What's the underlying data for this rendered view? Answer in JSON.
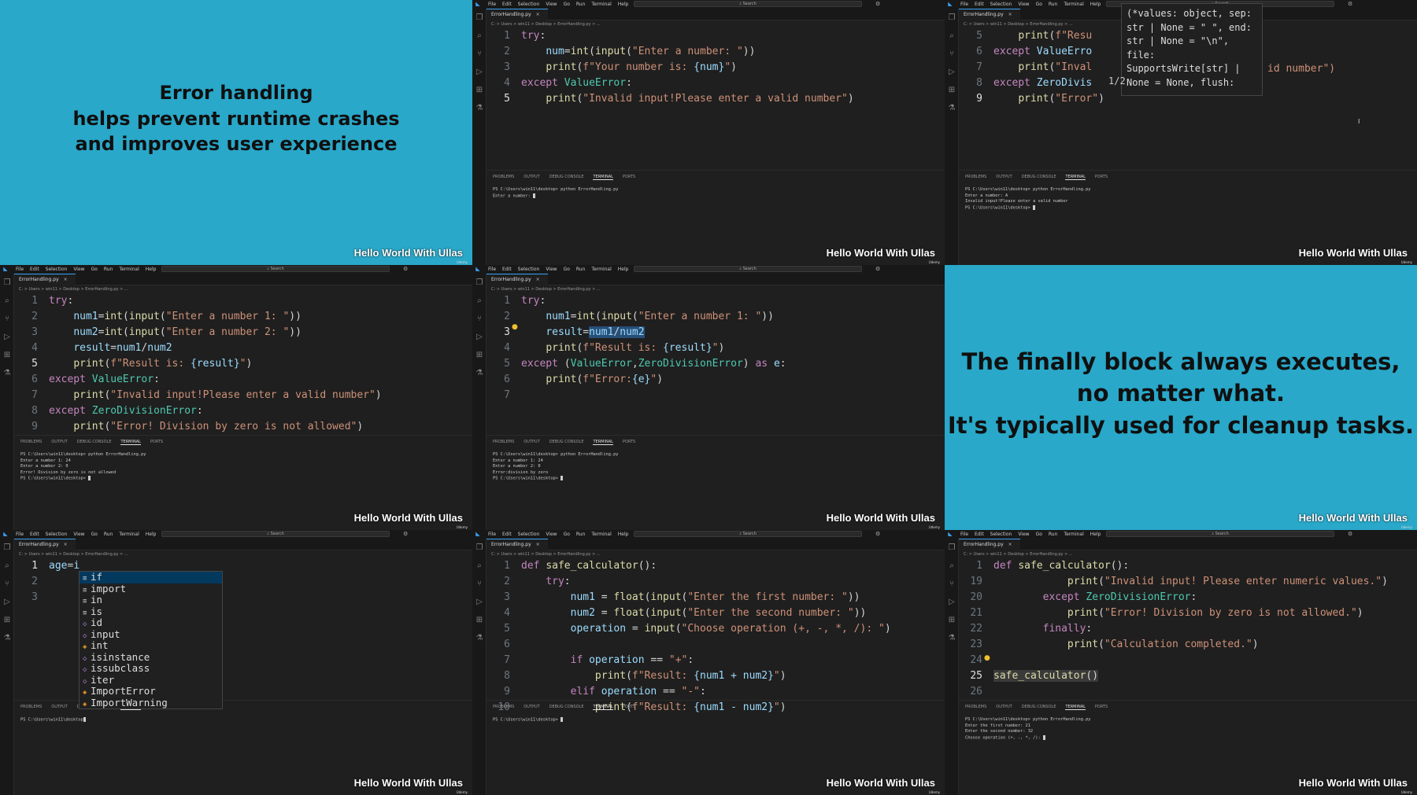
{
  "watermark": "Hello World With Ullas",
  "watermark_sub": "Udemy",
  "slides": {
    "s1": [
      "Error handling",
      "helps prevent runtime crashes",
      "and improves user experience"
    ],
    "s2": [
      "The finally block always executes,",
      "no matter what.",
      "It's typically used for cleanup tasks."
    ]
  },
  "vscode": {
    "menu": [
      "File",
      "Edit",
      "Selection",
      "View",
      "Go",
      "Run",
      "Terminal",
      "Help"
    ],
    "nav": "← →",
    "search": "Search",
    "tab_label": "ErrorHandling.py",
    "tab_close": "×",
    "breadcrumb": "C: > Users > win11 > Desktop > ErrorHandling.py > ...",
    "panel_tabs": [
      "PROBLEMS",
      "OUTPUT",
      "DEBUG CONSOLE",
      "TERMINAL",
      "PORTS"
    ]
  },
  "panels": {
    "p2": {
      "lines": [
        {
          "n": "1",
          "t": "try:"
        },
        {
          "n": "2",
          "t": "    num=int(input(\"Enter a number: \"))"
        },
        {
          "n": "3",
          "t": "    print(f\"Your number is: {num}\")"
        },
        {
          "n": "4",
          "t": "except ValueError:"
        },
        {
          "n": "5",
          "t": "    print(\"Invalid input!Please enter a valid number\")"
        }
      ],
      "terminal": [
        "PS C:\\Users\\win11\\desktop> python ErrorHandling.py",
        "Enter a number: "
      ]
    },
    "p3": {
      "lines": [
        {
          "n": "5",
          "t": "    print(f\"Resu"
        },
        {
          "n": "6",
          "t": "except ValueErro"
        },
        {
          "n": "7",
          "t": "    print(\"Inval"
        },
        {
          "n": "8",
          "t": "except ZeroDivis"
        },
        {
          "n": "9",
          "t": "    print(\"Error\")"
        }
      ],
      "hover": "(*values: object, sep:\nstr | None = \" \", end:\nstr | None = \"\\n\",\nfile:\nSupportsWrite[str] |\nNone = None, flush:",
      "hover_count": "1/2",
      "tail_text": "id number\")",
      "terminal": [
        "PS C:\\Users\\win11\\desktop> python ErrorHandling.py",
        "Enter a number: A",
        "Invalid input!Please enter a valid number",
        "PS C:\\Users\\win11\\desktop> "
      ]
    },
    "p4": {
      "lines": [
        {
          "n": "1",
          "t": "try:"
        },
        {
          "n": "2",
          "t": "    num1=int(input(\"Enter a number 1: \"))"
        },
        {
          "n": "3",
          "t": "    num2=int(input(\"Enter a number 2: \"))"
        },
        {
          "n": "4",
          "t": "    result=num1/num2"
        },
        {
          "n": "5",
          "t": "    print(f\"Result is: {result}\")"
        },
        {
          "n": "6",
          "t": "except ValueError:"
        },
        {
          "n": "7",
          "t": "    print(\"Invalid input!Please enter a valid number\")"
        },
        {
          "n": "8",
          "t": "except ZeroDivisionError:"
        },
        {
          "n": "9",
          "t": "    print(\"Error! Division by zero is not allowed\")"
        }
      ],
      "terminal": [
        "PS C:\\Users\\win11\\desktop> python ErrorHandling.py",
        "Enter a number 1: 24",
        "Enter a number 2: 0",
        "Error! Division by zero is not allowed",
        "PS C:\\Users\\win11\\desktop> "
      ]
    },
    "p5": {
      "lines": [
        {
          "n": "1",
          "t": "try:"
        },
        {
          "n": "2",
          "t": "    num1=int(input(\"Enter a number 1: \"))"
        },
        {
          "n": "3",
          "t": "    result=num1/num2"
        },
        {
          "n": "4",
          "t": "    print(f\"Result is: {result}\")"
        },
        {
          "n": "5",
          "t": "except (ValueError,ZeroDivisionError) as e:"
        },
        {
          "n": "6",
          "t": "    print(f\"Error:{e}\")"
        },
        {
          "n": "7",
          "t": ""
        }
      ],
      "terminal": [
        "PS C:\\Users\\win11\\desktop> python ErrorHandling.py",
        "Enter a number 1: 24",
        "Enter a number 2: 0",
        "Error:division by zero",
        "PS C:\\Users\\win11\\desktop> "
      ]
    },
    "p7": {
      "lines": [
        {
          "n": "1",
          "t": "age=i"
        },
        {
          "n": "2",
          "t": ""
        },
        {
          "n": "3",
          "t": ""
        }
      ],
      "suggestions": [
        {
          "icon": "≡",
          "label": "if"
        },
        {
          "icon": "≡",
          "label": "import"
        },
        {
          "icon": "≡",
          "label": "in"
        },
        {
          "icon": "≡",
          "label": "is"
        },
        {
          "icon": "◇",
          "label": "id"
        },
        {
          "icon": "◇",
          "label": "input"
        },
        {
          "icon": "◈",
          "label": "int"
        },
        {
          "icon": "◇",
          "label": "isinstance"
        },
        {
          "icon": "◇",
          "label": "issubclass"
        },
        {
          "icon": "◇",
          "label": "iter"
        },
        {
          "icon": "◈",
          "label": "ImportError"
        },
        {
          "icon": "◈",
          "label": "ImportWarning"
        }
      ],
      "terminal": [
        "PS C:\\Users\\win11\\desktop"
      ]
    },
    "p8": {
      "lines": [
        {
          "n": "1",
          "t": "def safe_calculator():"
        },
        {
          "n": "2",
          "t": "    try:"
        },
        {
          "n": "3",
          "t": "        num1 = float(input(\"Enter the first number: \"))"
        },
        {
          "n": "4",
          "t": "        num2 = float(input(\"Enter the second number: \"))"
        },
        {
          "n": "5",
          "t": "        operation = input(\"Choose operation (+, -, *, /): \")"
        },
        {
          "n": "6",
          "t": ""
        },
        {
          "n": "7",
          "t": "        if operation == \"+\":"
        },
        {
          "n": "8",
          "t": "            print(f\"Result: {num1 + num2}\")"
        },
        {
          "n": "9",
          "t": "        elif operation == \"-\":"
        },
        {
          "n": "10",
          "t": "            print(f\"Result: {num1 - num2}\")"
        }
      ],
      "terminal": [
        "PS C:\\Users\\win11\\desktop> "
      ]
    },
    "p9": {
      "lines": [
        {
          "n": "1",
          "t": "def safe_calculator():"
        },
        {
          "n": "19",
          "t": "            print(\"Invalid input! Please enter numeric values.\")"
        },
        {
          "n": "20",
          "t": "        except ZeroDivisionError:"
        },
        {
          "n": "21",
          "t": "            print(\"Error! Division by zero is not allowed.\")"
        },
        {
          "n": "22",
          "t": "        finally:"
        },
        {
          "n": "23",
          "t": "            print(\"Calculation completed.\")"
        },
        {
          "n": "24",
          "t": ""
        },
        {
          "n": "25",
          "t": "safe_calculator()"
        },
        {
          "n": "26",
          "t": ""
        }
      ],
      "terminal": [
        "PS C:\\Users\\win11\\desktop> python ErrorHandling.py",
        "Enter the first number: 21",
        "Enter the second number: 32",
        "Choose operation (+, -, *, /): "
      ]
    }
  },
  "icons": {
    "explorer": "❐",
    "search": "⌕",
    "scm": "⑂",
    "run": "▷",
    "extensions": "⊞",
    "test": "⚗"
  }
}
